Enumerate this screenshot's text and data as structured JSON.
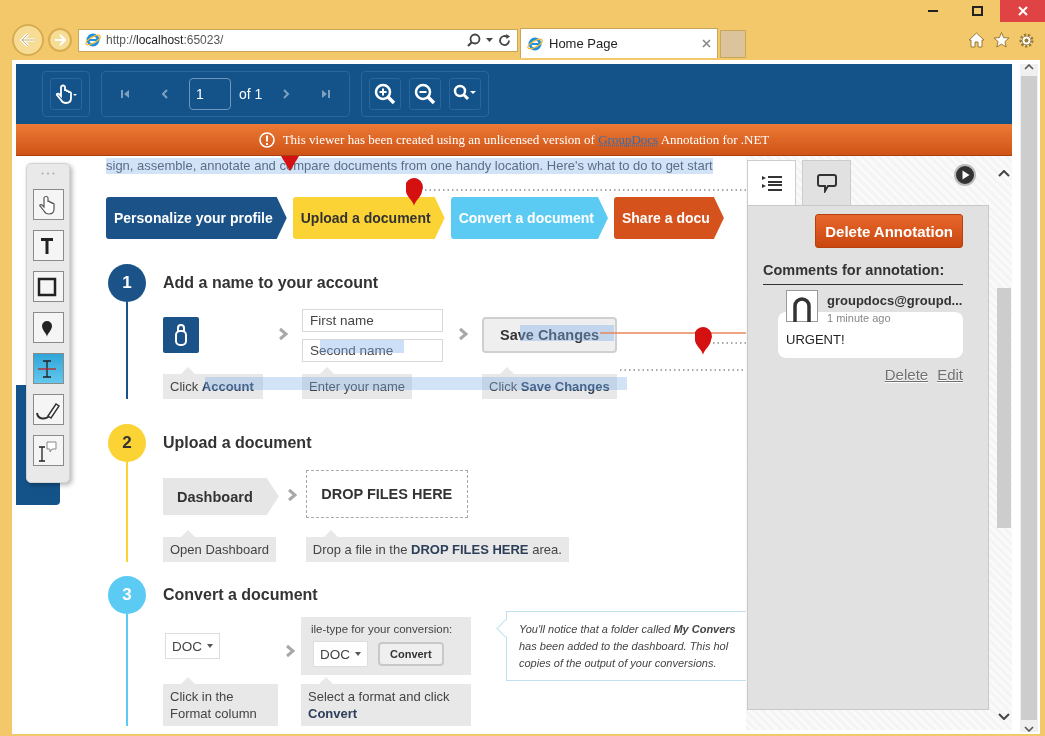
{
  "browser": {
    "address": "http://**localhost**:65023/",
    "tabs": [
      {
        "title": "Home Page",
        "selected": true
      }
    ]
  },
  "viewer_toolbar": {
    "page_number": "1",
    "page_count": "of 1",
    "nav_buttons": [
      {
        "kind": "first",
        "disabled": true
      },
      {
        "kind": "previous",
        "disabled": true
      },
      {
        "kind": "next",
        "disabled": true
      },
      {
        "kind": "last",
        "disabled": true
      }
    ]
  },
  "banner": {
    "text_before": "This viewer has been created using an unlicensed version of",
    "link": "GroupDocs",
    "text_after": "Annotation for .NET"
  },
  "tools": [
    {
      "kind": "pan",
      "selected": false
    },
    {
      "kind": "text",
      "selected": false
    },
    {
      "kind": "rectangle",
      "selected": false
    },
    {
      "kind": "point",
      "selected": false
    },
    {
      "kind": "text-select",
      "selected": true
    },
    {
      "kind": "draw",
      "selected": false
    },
    {
      "kind": "text-comment",
      "selected": false
    }
  ],
  "document": {
    "intro": "sign, assemble, annotate and compare documents from one handy location. Here's what to do to get start",
    "steps": [
      {
        "label": "Personalize your profile",
        "color": "#1b5389"
      },
      {
        "label": "Upload a document",
        "color": "#fbd334"
      },
      {
        "label": "Convert a document",
        "color": "#5ccbf3"
      },
      {
        "label": "Share a docu",
        "color": "#d6521c"
      }
    ],
    "sections": [
      {
        "number": "1",
        "color": "#1b5389",
        "title": "Add a name to your account",
        "items": [
          {
            "kind": "account",
            "caption": "Click **Account**"
          },
          {
            "kind": "fields",
            "fields": [
              "First name",
              "Second name"
            ],
            "caption": "Enter your name"
          },
          {
            "kind": "button",
            "label": "Save Changes",
            "caption": "Click **Save Changes**"
          }
        ]
      },
      {
        "number": "2",
        "color": "#fbd334",
        "title": "Upload a document",
        "items": [
          {
            "kind": "tab",
            "label": "Dashboard",
            "caption": "Open Dashboard"
          },
          {
            "kind": "dropzone",
            "label": "DROP FILES HERE",
            "caption": "Drop a file in the **DROP FILES HERE** area."
          }
        ]
      },
      {
        "number": "3",
        "color": "#5ccbf3",
        "title": "Convert a document",
        "items": [
          {
            "kind": "dropdown",
            "label": "DOC",
            "caption": "Click in the Format column"
          },
          {
            "kind": "convert",
            "heading": "ile-type for your conversion:",
            "dropdown": "DOC",
            "button": "Convert",
            "caption": "Select a format and click **Convert**"
          },
          {
            "kind": "note",
            "lines": [
              "You'll notice that a folder called **My Convers**",
              "has been added to the dashboard. This hol",
              "copies of the output of your conversions."
            ]
          }
        ]
      }
    ]
  },
  "panel": {
    "tabs": [
      {
        "kind": "list",
        "selected": false
      },
      {
        "kind": "comments",
        "selected": true
      }
    ],
    "delete_button": "Delete Annotation",
    "heading": "Comments for annotation:",
    "comments": [
      {
        "author": "groupdocs@groupd...",
        "time": "1 minute ago",
        "text": "URGENT!",
        "actions": [
          "Delete",
          "Edit"
        ]
      }
    ]
  }
}
